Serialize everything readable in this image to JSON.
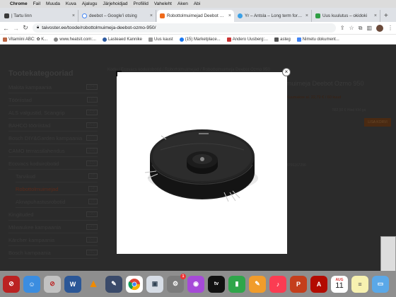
{
  "menubar": {
    "app": "Chrome",
    "items": [
      "Fail",
      "Muuda",
      "Kuva",
      "Ajalugu",
      "Järjehoidjad",
      "Profiilid",
      "Vaheleht",
      "Aken",
      "Abi"
    ]
  },
  "tabs": [
    {
      "title": "| Tartu linn",
      "favcolor": "#3a3a3a",
      "active": false
    },
    {
      "title": "deebot – Google'i otsing",
      "favcolor": "#4285f4",
      "active": false
    },
    {
      "title": "Robottolmuimejad Deebot Ozmo 950",
      "favcolor": "#f06a1a",
      "active": true
    },
    {
      "title": "Yr – Antsla – Long term forecast",
      "favcolor": "#3ba0e6",
      "active": false
    },
    {
      "title": "Uus kuulutus – okidoki",
      "favcolor": "#2f9e44",
      "active": false
    }
  ],
  "address": {
    "url": "taivoster.ee/toode/robottolmuimeja-deebot-ozmo-950/"
  },
  "bookmarks": [
    {
      "label": "Vitamiini ABC: ✿ K...",
      "color": "#b64"
    },
    {
      "label": "www.heatsit.com:...",
      "color": "#888"
    },
    {
      "label": "Lasteaed Kannike",
      "color": "#2c5aa0"
    },
    {
      "label": "Uus kaust",
      "color": "#999"
    },
    {
      "label": "(15) Marketplace...",
      "color": "#1877f2"
    },
    {
      "label": "Andero Uusberg:...",
      "color": "#c33"
    },
    {
      "label": "asteg",
      "color": "#555"
    },
    {
      "label": "Nimetu dokument...",
      "color": "#4285f4"
    }
  ],
  "page": {
    "sidebar_title": "Tootekategooriad",
    "categories": [
      {
        "label": "Makita kampaania",
        "count": "(84)",
        "level": 0
      },
      {
        "label": "Tööriistad",
        "count": "(11)",
        "level": 0
      },
      {
        "label": "ALS valgustid, Scangrip",
        "count": "(13)",
        "level": 0
      },
      {
        "label": "BAHCO tööriistad",
        "count": "(53)",
        "level": 0
      },
      {
        "label": "Bosch DIY&Garden kampaania",
        "count": "(27)",
        "level": 0
      },
      {
        "label": "CAMO terrassilahendus",
        "count": "(19)",
        "level": 0
      },
      {
        "label": "Ecovacs koduirobotid",
        "count": "(15)",
        "level": 0
      },
      {
        "label": "Tarvikud",
        "count": "(8)",
        "level": 1
      },
      {
        "label": "Robottolmuimejad",
        "count": "(4)",
        "level": 1
      },
      {
        "label": "Aknapuhastusrobotid",
        "count": "(3)",
        "level": 1
      },
      {
        "label": "Kingituded",
        "count": "(35)",
        "level": 0
      },
      {
        "label": "Milwaukee kampaania",
        "count": "(43)",
        "level": 0
      },
      {
        "label": "Kärcher kampaania",
        "count": "(52)",
        "level": 0
      },
      {
        "label": "Bosch kampaania",
        "count": "(41)",
        "level": 0
      }
    ],
    "breadcrumb": "Kodu / Ecovacs koduirobotid / Robottolmuimejad / Robottolmuimeja Deebot Ozmo 950",
    "product_title": "muimeja Deebot Ozmo 950",
    "line1": "Kuumakse al. 22,79 € / 60 kuud",
    "price_note": "582,50 € Hind KM-ga",
    "buy_label": "LISA KORVI",
    "code": "3756167296"
  },
  "modal": {
    "close": "×",
    "image_alt": "Robottolmuimeja Deebot Ozmo 950"
  },
  "dock": {
    "calendar_month": "AUG",
    "calendar_day": "11",
    "badge": "1"
  }
}
